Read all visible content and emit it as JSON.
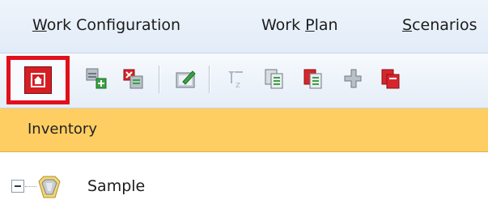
{
  "menu": {
    "items": [
      {
        "label": "Work Configuration"
      },
      {
        "label": "Work Plan"
      },
      {
        "label": "Scenarios"
      }
    ]
  },
  "toolbar": {
    "buttons": [
      {
        "icon": "home-icon",
        "selected": true
      },
      {
        "icon": "add-config-icon"
      },
      {
        "icon": "delete-config-icon"
      },
      {
        "icon": "edit-config-icon"
      },
      {
        "icon": "sort-icon"
      },
      {
        "icon": "copy-document-icon"
      },
      {
        "icon": "red-document-icon"
      },
      {
        "icon": "connector-icon"
      },
      {
        "icon": "red-document-arrow-icon"
      }
    ]
  },
  "panel": {
    "title": "Inventory"
  },
  "tree": {
    "root": {
      "label": "Sample",
      "expanded": true
    }
  },
  "colors": {
    "highlight": "#e1101c",
    "panel_header": "#ffce63",
    "home_button": "#d51f24"
  }
}
